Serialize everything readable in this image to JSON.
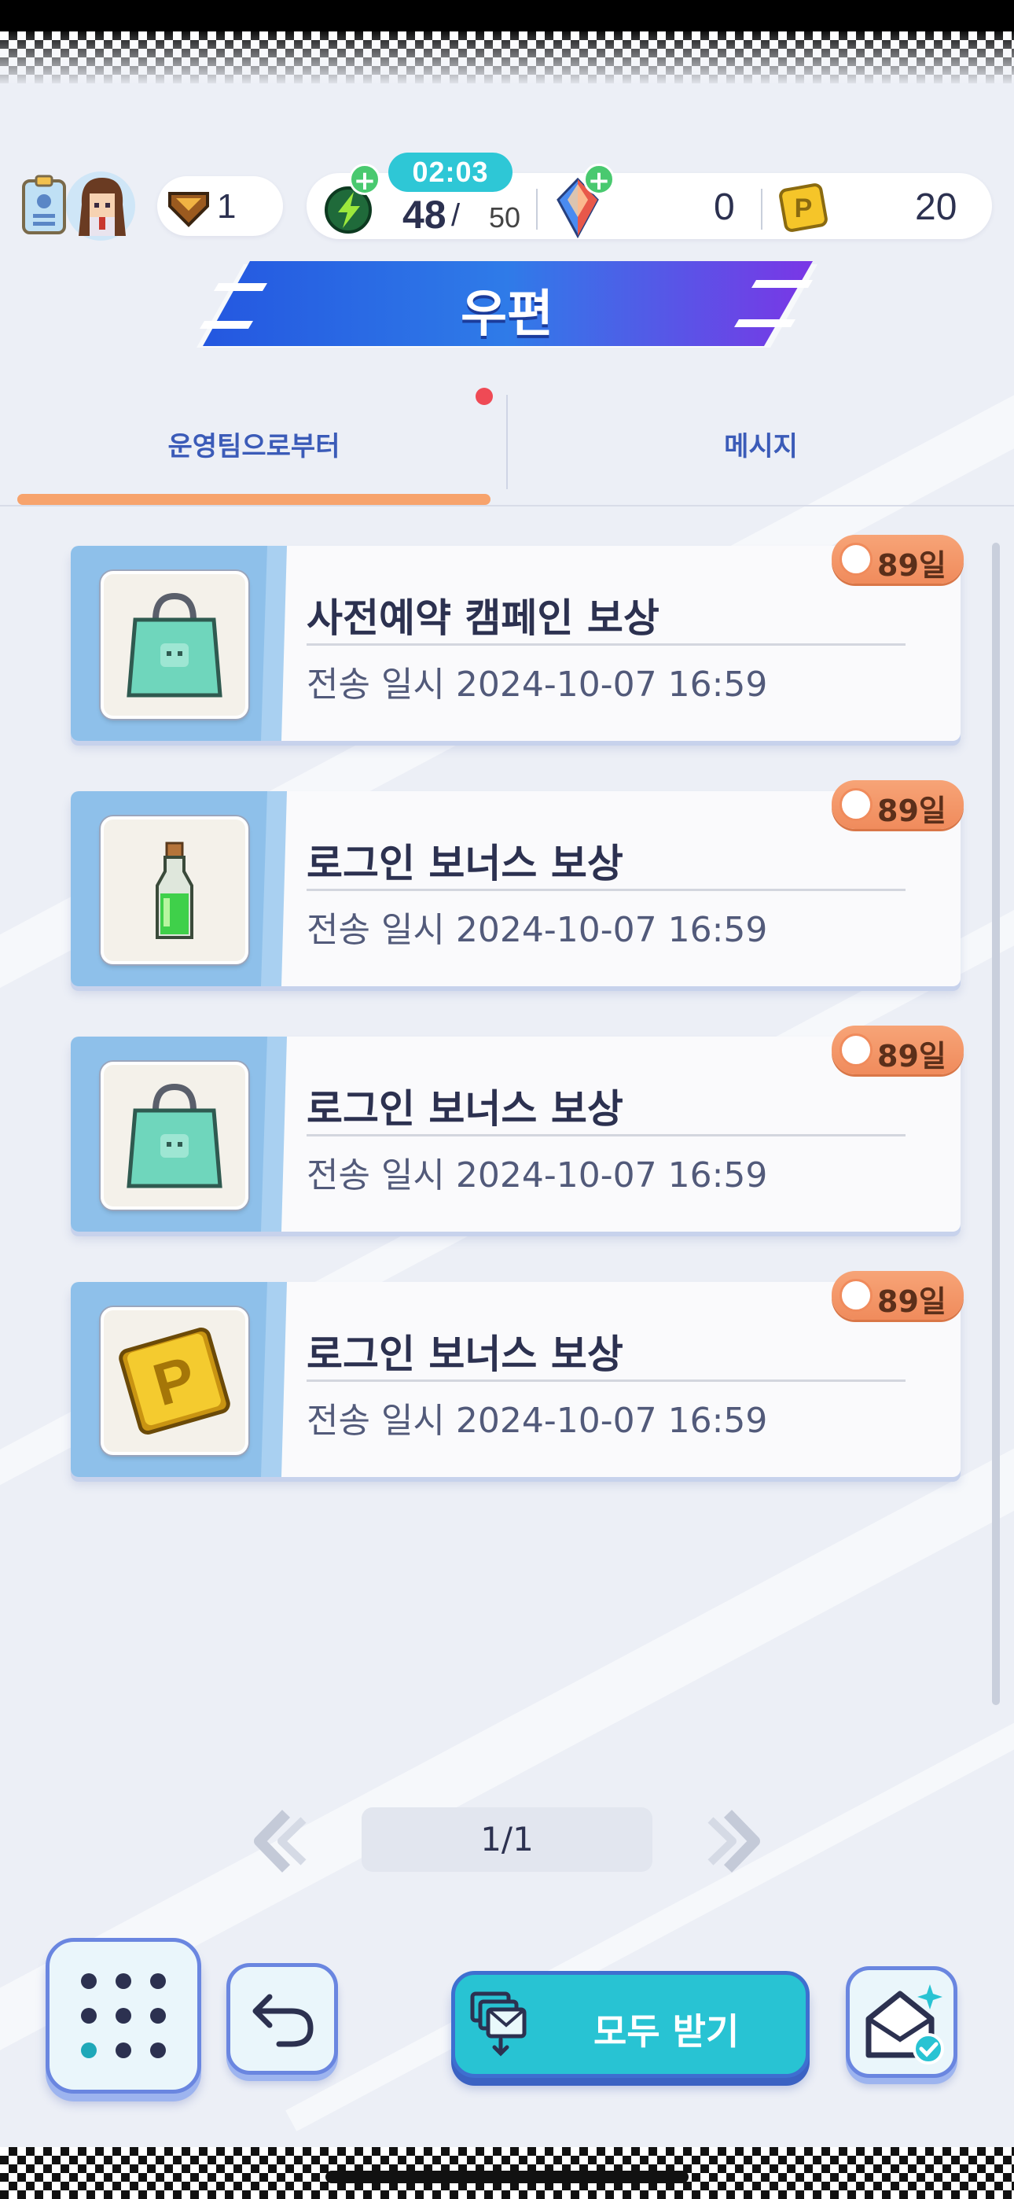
{
  "status": {
    "timer": "02:03",
    "level": "1",
    "stamina_current": "48",
    "stamina_sep": "/",
    "stamina_max": "50",
    "gems": "0",
    "points": "20"
  },
  "title": "우편",
  "tabs": [
    {
      "label": "운영팀으로부터",
      "active": true,
      "has_badge": true
    },
    {
      "label": "메시지",
      "active": false
    }
  ],
  "mails": [
    {
      "title": "사전예약 캠페인 보상",
      "date": "전송 일시 2024-10-07 16:59",
      "days_left": "89일",
      "item_icon": "teal-bag-icon"
    },
    {
      "title": "로그인 보너스 보상",
      "date": "전송 일시 2024-10-07 16:59",
      "days_left": "89일",
      "item_icon": "green-potion-icon"
    },
    {
      "title": "로그인 보너스 보상",
      "date": "전송 일시 2024-10-07 16:59",
      "days_left": "89일",
      "item_icon": "teal-bag-icon"
    },
    {
      "title": "로그인 보너스 보상",
      "date": "전송 일시 2024-10-07 16:59",
      "days_left": "89일",
      "item_icon": "gold-p-coin-icon"
    }
  ],
  "pagination": {
    "label": "1/1"
  },
  "buttons": {
    "receive_all": "모두 받기"
  },
  "colors": {
    "accent_teal": "#28c3d3",
    "accent_blue": "#3e6fd0",
    "tab_underline": "#f7a36c",
    "badge_orange": "#f08b5c"
  }
}
